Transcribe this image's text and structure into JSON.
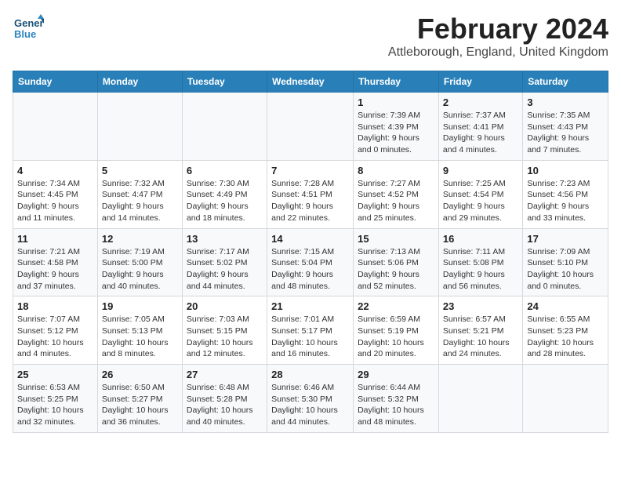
{
  "header": {
    "logo_line1": "General",
    "logo_line2": "Blue",
    "title": "February 2024",
    "subtitle": "Attleborough, England, United Kingdom"
  },
  "weekdays": [
    "Sunday",
    "Monday",
    "Tuesday",
    "Wednesday",
    "Thursday",
    "Friday",
    "Saturday"
  ],
  "weeks": [
    [
      {
        "day": "",
        "info": ""
      },
      {
        "day": "",
        "info": ""
      },
      {
        "day": "",
        "info": ""
      },
      {
        "day": "",
        "info": ""
      },
      {
        "day": "1",
        "info": "Sunrise: 7:39 AM\nSunset: 4:39 PM\nDaylight: 9 hours\nand 0 minutes."
      },
      {
        "day": "2",
        "info": "Sunrise: 7:37 AM\nSunset: 4:41 PM\nDaylight: 9 hours\nand 4 minutes."
      },
      {
        "day": "3",
        "info": "Sunrise: 7:35 AM\nSunset: 4:43 PM\nDaylight: 9 hours\nand 7 minutes."
      }
    ],
    [
      {
        "day": "4",
        "info": "Sunrise: 7:34 AM\nSunset: 4:45 PM\nDaylight: 9 hours\nand 11 minutes."
      },
      {
        "day": "5",
        "info": "Sunrise: 7:32 AM\nSunset: 4:47 PM\nDaylight: 9 hours\nand 14 minutes."
      },
      {
        "day": "6",
        "info": "Sunrise: 7:30 AM\nSunset: 4:49 PM\nDaylight: 9 hours\nand 18 minutes."
      },
      {
        "day": "7",
        "info": "Sunrise: 7:28 AM\nSunset: 4:51 PM\nDaylight: 9 hours\nand 22 minutes."
      },
      {
        "day": "8",
        "info": "Sunrise: 7:27 AM\nSunset: 4:52 PM\nDaylight: 9 hours\nand 25 minutes."
      },
      {
        "day": "9",
        "info": "Sunrise: 7:25 AM\nSunset: 4:54 PM\nDaylight: 9 hours\nand 29 minutes."
      },
      {
        "day": "10",
        "info": "Sunrise: 7:23 AM\nSunset: 4:56 PM\nDaylight: 9 hours\nand 33 minutes."
      }
    ],
    [
      {
        "day": "11",
        "info": "Sunrise: 7:21 AM\nSunset: 4:58 PM\nDaylight: 9 hours\nand 37 minutes."
      },
      {
        "day": "12",
        "info": "Sunrise: 7:19 AM\nSunset: 5:00 PM\nDaylight: 9 hours\nand 40 minutes."
      },
      {
        "day": "13",
        "info": "Sunrise: 7:17 AM\nSunset: 5:02 PM\nDaylight: 9 hours\nand 44 minutes."
      },
      {
        "day": "14",
        "info": "Sunrise: 7:15 AM\nSunset: 5:04 PM\nDaylight: 9 hours\nand 48 minutes."
      },
      {
        "day": "15",
        "info": "Sunrise: 7:13 AM\nSunset: 5:06 PM\nDaylight: 9 hours\nand 52 minutes."
      },
      {
        "day": "16",
        "info": "Sunrise: 7:11 AM\nSunset: 5:08 PM\nDaylight: 9 hours\nand 56 minutes."
      },
      {
        "day": "17",
        "info": "Sunrise: 7:09 AM\nSunset: 5:10 PM\nDaylight: 10 hours\nand 0 minutes."
      }
    ],
    [
      {
        "day": "18",
        "info": "Sunrise: 7:07 AM\nSunset: 5:12 PM\nDaylight: 10 hours\nand 4 minutes."
      },
      {
        "day": "19",
        "info": "Sunrise: 7:05 AM\nSunset: 5:13 PM\nDaylight: 10 hours\nand 8 minutes."
      },
      {
        "day": "20",
        "info": "Sunrise: 7:03 AM\nSunset: 5:15 PM\nDaylight: 10 hours\nand 12 minutes."
      },
      {
        "day": "21",
        "info": "Sunrise: 7:01 AM\nSunset: 5:17 PM\nDaylight: 10 hours\nand 16 minutes."
      },
      {
        "day": "22",
        "info": "Sunrise: 6:59 AM\nSunset: 5:19 PM\nDaylight: 10 hours\nand 20 minutes."
      },
      {
        "day": "23",
        "info": "Sunrise: 6:57 AM\nSunset: 5:21 PM\nDaylight: 10 hours\nand 24 minutes."
      },
      {
        "day": "24",
        "info": "Sunrise: 6:55 AM\nSunset: 5:23 PM\nDaylight: 10 hours\nand 28 minutes."
      }
    ],
    [
      {
        "day": "25",
        "info": "Sunrise: 6:53 AM\nSunset: 5:25 PM\nDaylight: 10 hours\nand 32 minutes."
      },
      {
        "day": "26",
        "info": "Sunrise: 6:50 AM\nSunset: 5:27 PM\nDaylight: 10 hours\nand 36 minutes."
      },
      {
        "day": "27",
        "info": "Sunrise: 6:48 AM\nSunset: 5:28 PM\nDaylight: 10 hours\nand 40 minutes."
      },
      {
        "day": "28",
        "info": "Sunrise: 6:46 AM\nSunset: 5:30 PM\nDaylight: 10 hours\nand 44 minutes."
      },
      {
        "day": "29",
        "info": "Sunrise: 6:44 AM\nSunset: 5:32 PM\nDaylight: 10 hours\nand 48 minutes."
      },
      {
        "day": "",
        "info": ""
      },
      {
        "day": "",
        "info": ""
      }
    ]
  ]
}
